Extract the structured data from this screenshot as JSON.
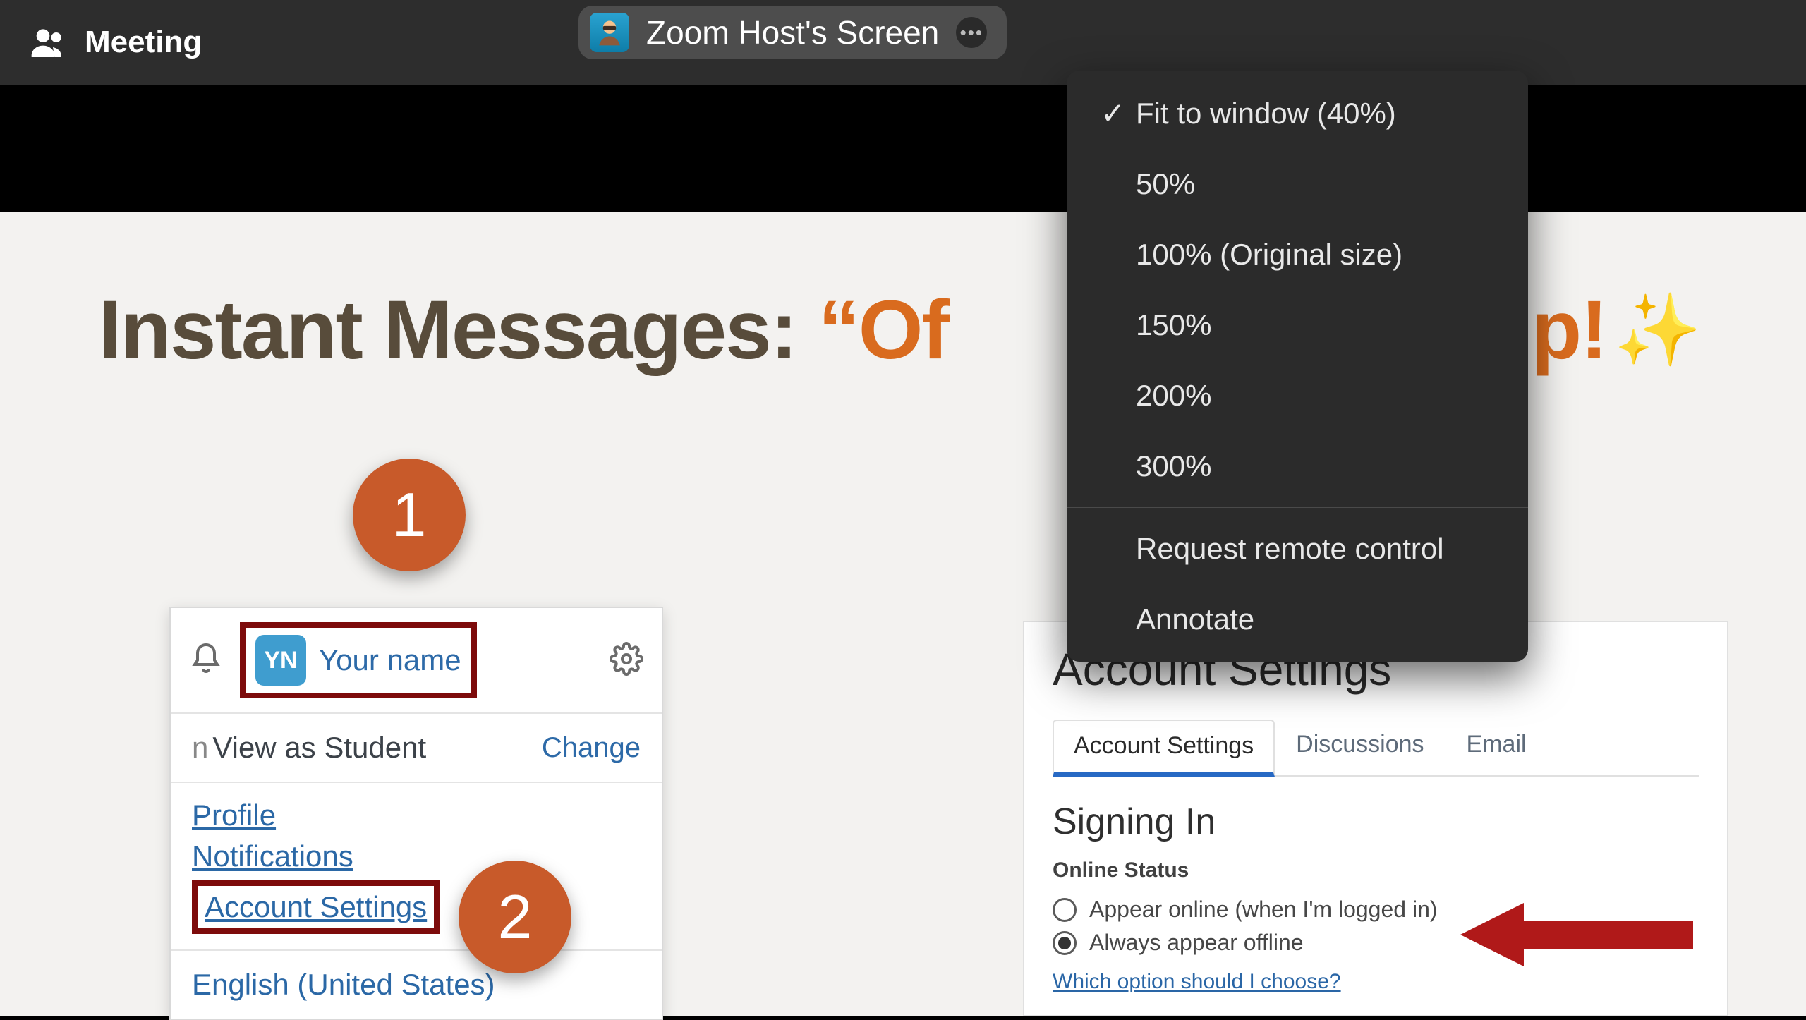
{
  "topbar": {
    "meeting_label": "Meeting",
    "share_label": "Zoom Host's Screen"
  },
  "menu": {
    "items": [
      {
        "label": "Fit to window (40%)",
        "checked": true
      },
      {
        "label": "50%",
        "checked": false
      },
      {
        "label": "100% (Original size)",
        "checked": false
      },
      {
        "label": "150%",
        "checked": false
      },
      {
        "label": "200%",
        "checked": false
      },
      {
        "label": "300%",
        "checked": false
      }
    ],
    "actions": [
      {
        "label": "Request remote control"
      },
      {
        "label": "Annotate"
      }
    ]
  },
  "slide": {
    "title_prefix": "Instant Messages: ",
    "title_quote": "“Of",
    "title_suffix": "ip!",
    "sparkle": "✨"
  },
  "left_panel": {
    "avatar_initials": "YN",
    "your_name": "Your name",
    "view_as": "View as Student",
    "change": "Change",
    "links": {
      "profile": "Profile",
      "notifications": "Notifications",
      "account_settings": "Account Settings"
    },
    "language": "English (United States)"
  },
  "right_panel": {
    "title": "Account Settings",
    "tabs": [
      "Account Settings",
      "Discussions",
      "Email"
    ],
    "section_title": "Signing In",
    "subhead": "Online Status",
    "radio1": "Appear online (when I'm logged in)",
    "radio2": "Always appear offline",
    "help": "Which option should I choose?"
  },
  "badges": {
    "one": "1",
    "two": "2"
  }
}
